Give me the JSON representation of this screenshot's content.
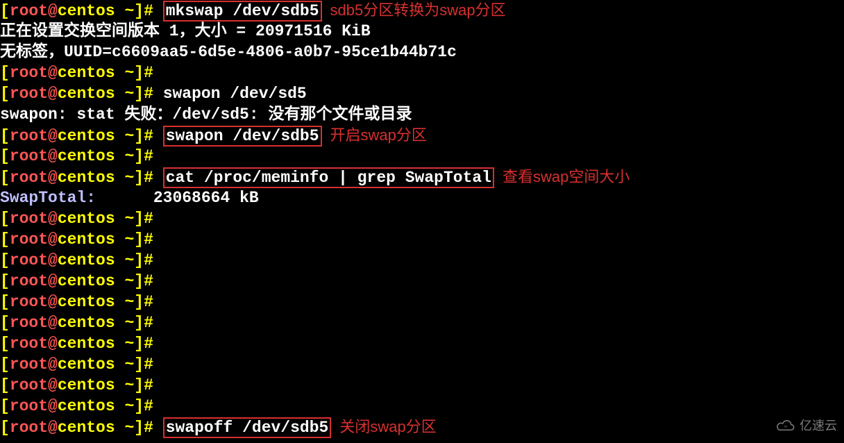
{
  "lines": [
    {
      "type": "prompt",
      "cmd": "mkswap /dev/sdb5",
      "boxed": true,
      "annotation": "sdb5分区转换为swap分区"
    },
    {
      "type": "output",
      "text": "正在设置交换空间版本 1，大小 = 20971516 KiB"
    },
    {
      "type": "output",
      "text": "无标签，UUID=c6609aa5-6d5e-4806-a0b7-95ce1b44b71c"
    },
    {
      "type": "prompt",
      "cmd": "",
      "boxed": false
    },
    {
      "type": "prompt",
      "cmd": "swapon /dev/sd5",
      "boxed": false
    },
    {
      "type": "output",
      "text": "swapon: stat 失败：/dev/sd5: 没有那个文件或目录"
    },
    {
      "type": "prompt",
      "cmd": "swapon /dev/sdb5",
      "boxed": true,
      "annotation": "开启swap分区"
    },
    {
      "type": "prompt",
      "cmd": "",
      "boxed": false
    },
    {
      "type": "prompt",
      "cmd": "cat /proc/meminfo | grep SwapTotal",
      "boxed": true,
      "annotation": "查看swap空间大小"
    },
    {
      "type": "swaptotal",
      "label": "SwapTotal:",
      "value": "      23068664 kB"
    },
    {
      "type": "prompt",
      "cmd": "",
      "boxed": false
    },
    {
      "type": "prompt",
      "cmd": "",
      "boxed": false
    },
    {
      "type": "prompt",
      "cmd": "",
      "boxed": false
    },
    {
      "type": "prompt",
      "cmd": "",
      "boxed": false
    },
    {
      "type": "prompt",
      "cmd": "",
      "boxed": false
    },
    {
      "type": "prompt",
      "cmd": "",
      "boxed": false
    },
    {
      "type": "prompt",
      "cmd": "",
      "boxed": false
    },
    {
      "type": "prompt",
      "cmd": "",
      "boxed": false
    },
    {
      "type": "prompt",
      "cmd": "",
      "boxed": false
    },
    {
      "type": "prompt",
      "cmd": "",
      "boxed": false
    },
    {
      "type": "prompt",
      "cmd": "swapoff /dev/sdb5",
      "boxed": true,
      "annotation": "关闭swap分区"
    }
  ],
  "prompt": {
    "open": "[",
    "user": "root",
    "at": "@",
    "host": "centos",
    "path": " ~",
    "close": "]",
    "dollar": "# "
  },
  "watermark": "亿速云"
}
